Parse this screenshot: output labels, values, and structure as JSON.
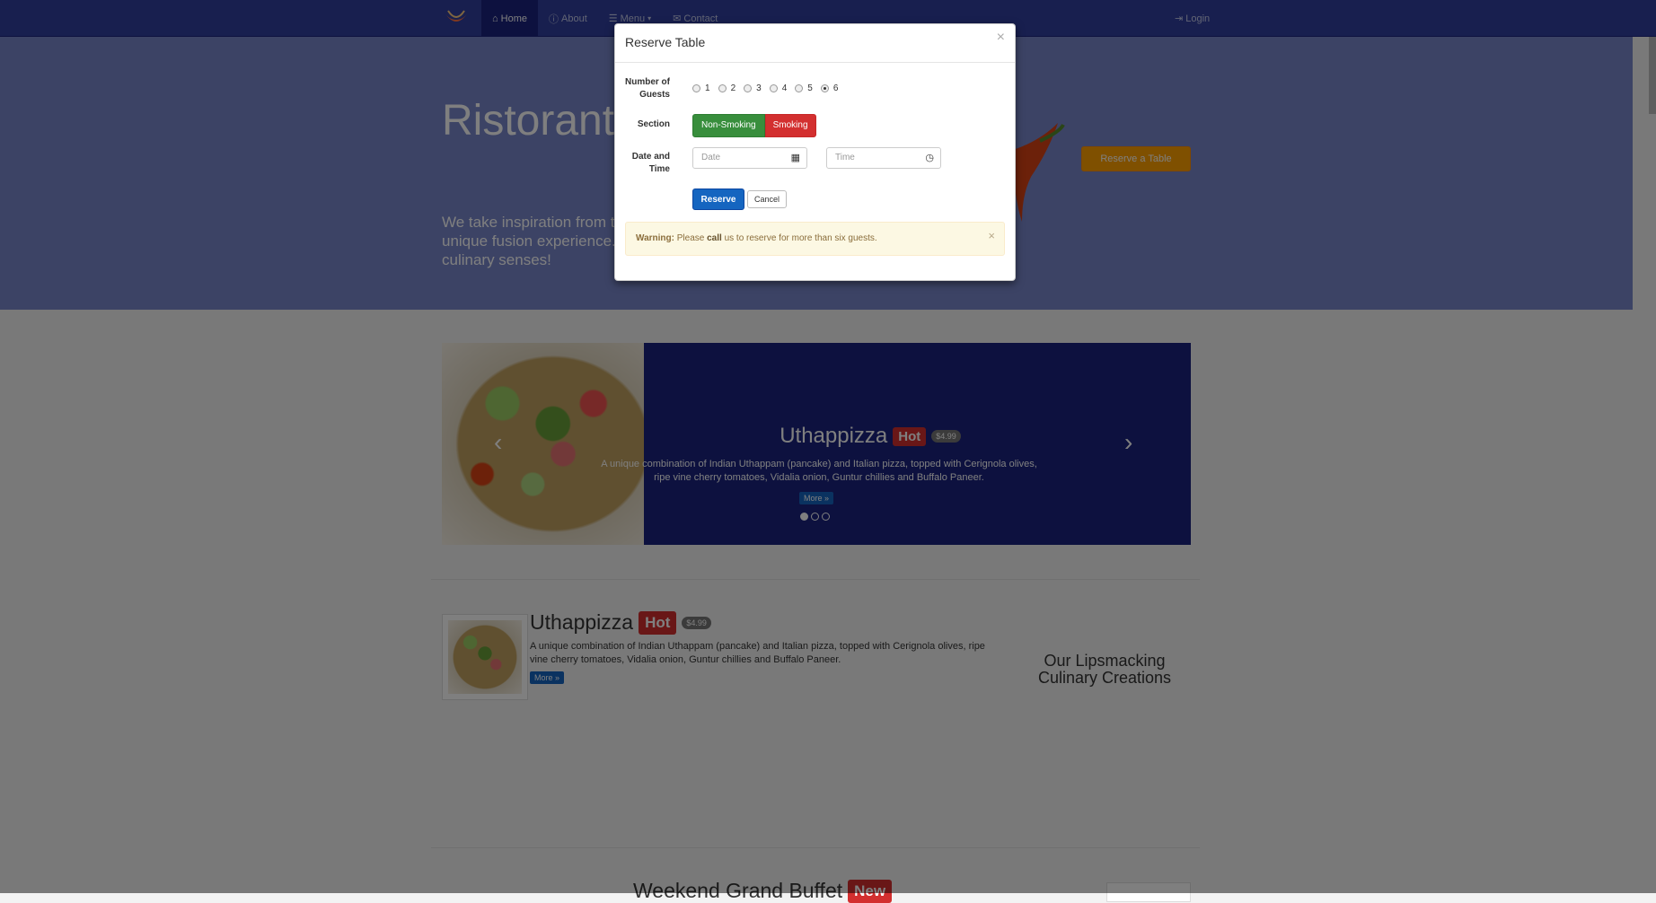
{
  "navbar": {
    "items": [
      {
        "label": "Home",
        "icon": "home-icon"
      },
      {
        "label": "About",
        "icon": "info-icon"
      },
      {
        "label": "Menu",
        "icon": "list-icon"
      },
      {
        "label": "Contact",
        "icon": "envelope-icon"
      }
    ],
    "login_label": "Login"
  },
  "jumbotron": {
    "title": "Ristorante con Fusion",
    "text": "We take inspiration from the World's best cuisines, and create a unique fusion experience. Our lipsmacking creations will tickle your culinary senses!",
    "reserve_label": "Reserve a Table"
  },
  "carousel": {
    "title": "Uthappizza",
    "label": "Hot",
    "price": "$4.99",
    "description": "A unique combination of Indian Uthappam (pancake) and Italian pizza, topped with Cerignola olives, ripe vine cherry tomatoes, Vidalia onion, Guntur chillies and Buffalo Paneer.",
    "more": "More »",
    "active_index": 0
  },
  "featured": {
    "title": "Uthappizza",
    "label": "Hot",
    "price": "$4.99",
    "description": "A unique combination of Indian Uthappam (pancake) and Italian pizza, topped with Cerignola olives, ripe vine cherry tomatoes, Vidalia onion, Guntur chillies and Buffalo Paneer.",
    "more": "More »",
    "side_heading": "Our Lipsmacking Culinary Creations"
  },
  "next_section": {
    "title": "Weekend Grand Buffet",
    "label": "New"
  },
  "modal": {
    "title": "Reserve Table",
    "close": "×",
    "guests_label": "Number of Guests",
    "guest_options": [
      "1",
      "2",
      "3",
      "4",
      "5",
      "6"
    ],
    "guests_selected": "6",
    "section_label": "Section",
    "section_options": [
      "Non-Smoking",
      "Smoking"
    ],
    "datetime_label": "Date and Time",
    "date_placeholder": "Date",
    "time_placeholder": "Time",
    "reserve_label": "Reserve",
    "cancel_label": "Cancel",
    "warning": {
      "strong": "Warning:",
      "pre": "Please",
      "call": "call",
      "post": "us to reserve for more than six guests.",
      "close": "×"
    }
  },
  "colors": {
    "navbar": "#303f9f",
    "jumbotron": "#7986cb",
    "carousel_bg": "#1a237e",
    "hot_label": "#d32f2f",
    "reserve_button": "#ffa000",
    "primary": "#1565c0",
    "success": "#388e3c",
    "warning_bg": "#fcf8e3"
  }
}
